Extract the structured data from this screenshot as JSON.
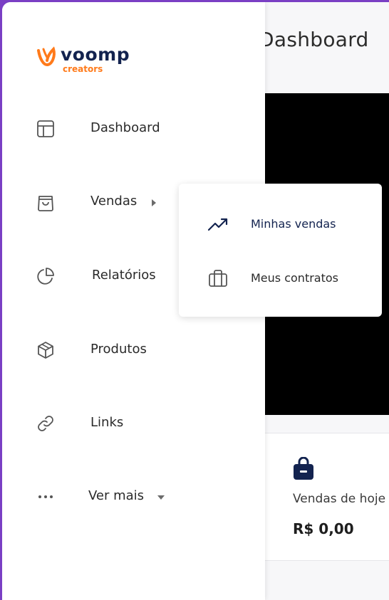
{
  "header": {
    "title": "Dashboard"
  },
  "brand": {
    "name": "voomp",
    "tagline": "creators",
    "primary_color": "#13234f",
    "accent_color": "#ff7a1a"
  },
  "sidebar": {
    "items": [
      {
        "label": "Dashboard",
        "icon": "layout-icon"
      },
      {
        "label": "Vendas",
        "icon": "shopping-bag-icon",
        "expanded": true
      },
      {
        "label": "Relatórios",
        "icon": "pie-chart-icon"
      },
      {
        "label": "Produtos",
        "icon": "package-icon"
      },
      {
        "label": "Links",
        "icon": "link-icon"
      },
      {
        "label": "Ver mais",
        "icon": "more-horizontal-icon"
      }
    ]
  },
  "submenu": {
    "items": [
      {
        "label": "Minhas vendas",
        "icon": "trending-up-icon",
        "active": true
      },
      {
        "label": "Meus contratos",
        "icon": "briefcase-icon"
      }
    ]
  },
  "stats": {
    "today_sales": {
      "label": "Vendas de hoje",
      "value": "R$ 0,00",
      "icon": "shopping-bag-filled-icon"
    }
  }
}
